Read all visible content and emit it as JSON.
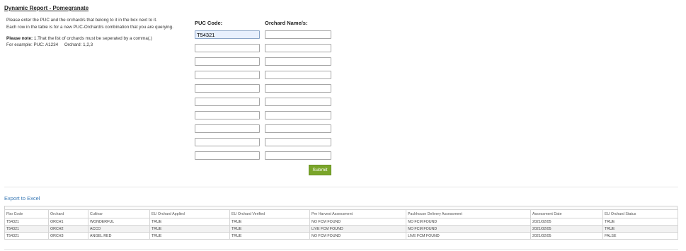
{
  "page": {
    "title": "Dynamic Report - Pomegranate",
    "instructions": [
      "Please enter the PUC and the orchard/s that belong to it in the box next to it.",
      "Each row in the table is for a new PUC-Orchard/s combination that you are querying."
    ],
    "note_label": "Please note:",
    "note_text": " 1.That the list of orchards must be seperated by a comma(,)",
    "example_text": "For example: PUC: A1234     Orchard: 1,2,3"
  },
  "form": {
    "puc_header": "PUC Code:",
    "orchard_header": "Orchard Name/s:",
    "rows": [
      {
        "puc": "T54321",
        "orchard": ""
      },
      {
        "puc": "",
        "orchard": ""
      },
      {
        "puc": "",
        "orchard": ""
      },
      {
        "puc": "",
        "orchard": ""
      },
      {
        "puc": "",
        "orchard": ""
      },
      {
        "puc": "",
        "orchard": ""
      },
      {
        "puc": "",
        "orchard": ""
      },
      {
        "puc": "",
        "orchard": ""
      },
      {
        "puc": "",
        "orchard": ""
      },
      {
        "puc": "",
        "orchard": ""
      }
    ],
    "submit_label": "Submit"
  },
  "export_label": "Export to Excel",
  "results": {
    "headers": [
      "Fbo Code",
      "Orchard",
      "Cultivar",
      "EU Orchard Applied",
      "EU Orchard Verified",
      "Pre Harvest Assessment",
      "Packhouse Delivery Assessment",
      "Assessment Date",
      "EU Orchard Status"
    ],
    "rows": [
      [
        "T54321",
        "ORCH1",
        "WONDERFUL",
        "TRUE",
        "TRUE",
        "NO FCM FOUND",
        "NO FCM FOUND",
        "2021/02/05",
        "TRUE"
      ],
      [
        "T54321",
        "ORCH2",
        "ACCO",
        "TRUE",
        "TRUE",
        "LIVE FCM FOUND",
        "NO FCM FOUND",
        "2021/02/05",
        "TRUE"
      ],
      [
        "T54321",
        "ORCH3",
        "ANGEL RED",
        "TRUE",
        "TRUE",
        "NO FCM FOUND",
        "LIVE FCM FOUND",
        "2021/02/05",
        "FALSE"
      ]
    ]
  },
  "colors": {
    "submit_bg": "#7aa52a",
    "link": "#3a79b5",
    "filled_input_bg": "#e8f0fe"
  }
}
